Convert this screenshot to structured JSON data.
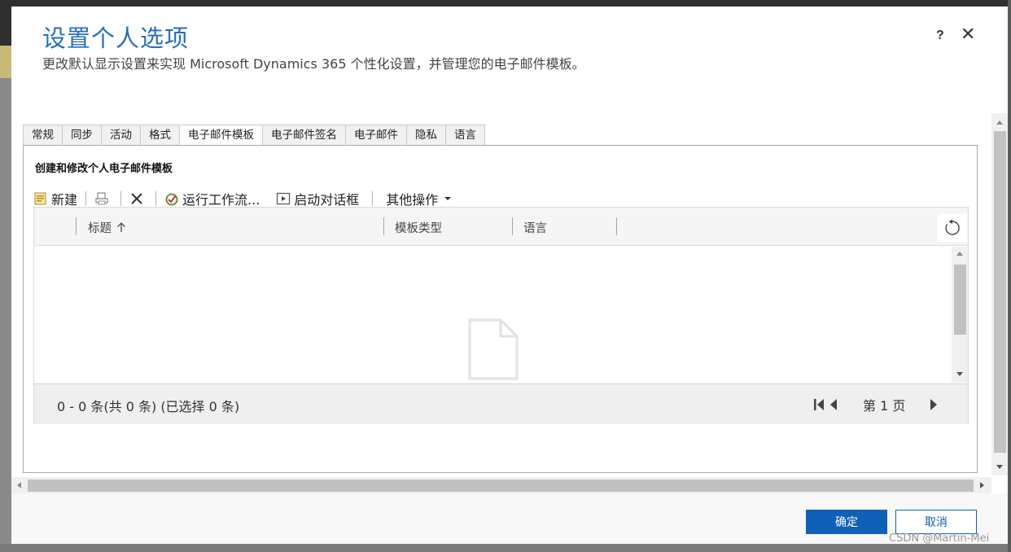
{
  "dialog": {
    "title": "设置个人选项",
    "subtitle": "更改默认显示设置来实现 Microsoft Dynamics 365 个性化设置，并管理您的电子邮件模板。",
    "help_label": "?",
    "close_label": "✕"
  },
  "tabs": [
    {
      "label": "常规"
    },
    {
      "label": "同步"
    },
    {
      "label": "活动"
    },
    {
      "label": "格式"
    },
    {
      "label": "电子邮件模板",
      "active": true
    },
    {
      "label": "电子邮件签名"
    },
    {
      "label": "电子邮件"
    },
    {
      "label": "隐私"
    },
    {
      "label": "语言"
    }
  ],
  "panel": {
    "section_title": "创建和修改个人电子邮件模板"
  },
  "toolbar": {
    "new_label": "新建",
    "run_workflow_label": "运行工作流...",
    "start_dialog_label": "启动对话框",
    "more_actions_label": "其他操作"
  },
  "grid": {
    "columns": [
      {
        "label": "标题",
        "sort": "asc"
      },
      {
        "label": "模板类型"
      },
      {
        "label": "语言"
      }
    ],
    "rows": [],
    "footer": {
      "record_count": "0 - 0  条(共 0 条) (已选择 0 条)",
      "page_label": "第 1 页"
    }
  },
  "footer": {
    "ok_label": "确定",
    "cancel_label": "取消",
    "watermark": "CSDN @Martin-Mei"
  },
  "colors": {
    "accent": "#1160b7",
    "title": "#2a6ebb"
  }
}
